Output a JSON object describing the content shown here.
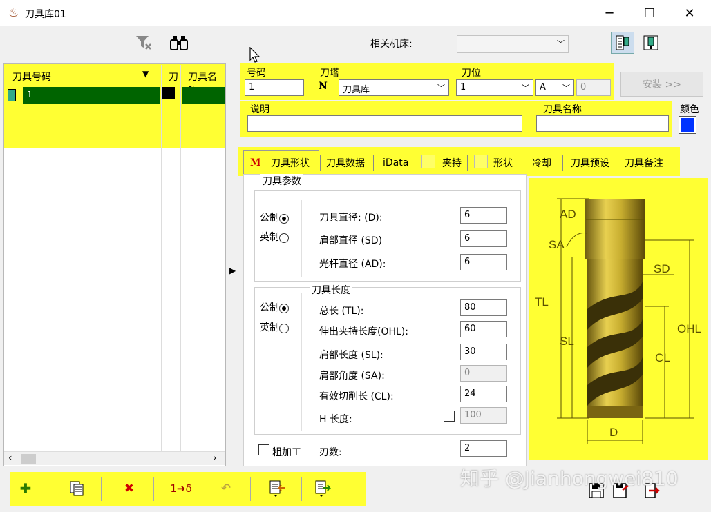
{
  "window": {
    "title": "刀具库01",
    "minimize": "─",
    "maximize": "☐",
    "close": "✕"
  },
  "toolbar_top": {
    "filter_clear_icon": "filter-clear-icon",
    "find_icon": "binoculars-icon",
    "machine_label": "相关机床:",
    "machine_value": ""
  },
  "grid": {
    "headers": [
      "刀具号码",
      "刀",
      "刀具名称"
    ],
    "rows": [
      {
        "number": "1",
        "name": ""
      }
    ]
  },
  "fields": {
    "number_label": "号码",
    "number_value": "1",
    "turret_label": "刀塔",
    "turret_prefix": "N",
    "turret_value": "刀具库",
    "position_label": "刀位",
    "position_value": "1",
    "position_sub": "A",
    "position_num": "0",
    "install_button": "安装 >>",
    "desc_label": "说明",
    "desc_value": "",
    "name_label": "刀具名称",
    "name_value": "",
    "color_label": "颜色",
    "color_value": "#0033ff"
  },
  "tabs": {
    "mark": "M",
    "items": [
      "刀具形状",
      "刀具数据",
      "iData",
      "夹持",
      "形状",
      "冷却",
      "刀具预设",
      "刀具备注"
    ]
  },
  "params": {
    "group_title": "刀具参数",
    "metric": "公制",
    "imperial": "英制",
    "unit_selected": "metric",
    "diameter_label": "刀具直径: (D):",
    "diameter_value": "6",
    "shoulder_dia_label": "肩部直径 (SD)",
    "shoulder_dia_value": "6",
    "shank_dia_label": "光杆直径 (AD):",
    "shank_dia_value": "6"
  },
  "lengths": {
    "group_title": "刀具长度",
    "metric": "公制",
    "imperial": "英制",
    "total_label": "总长 (TL):",
    "total_value": "80",
    "overhang_label": "伸出夹持长度(OHL):",
    "overhang_value": "60",
    "shoulder_len_label": "肩部长度 (SL):",
    "shoulder_len_value": "30",
    "shoulder_angle_label": "肩部角度 (SA):",
    "shoulder_angle_value": "0",
    "cutting_len_label": "有效切削长 (CL):",
    "cutting_len_value": "24",
    "h_len_label": "H 长度:",
    "h_len_value": "100",
    "rough_label": "粗加工",
    "flutes_label": "刃数:",
    "flutes_value": "2"
  },
  "diagram": {
    "AD": "AD",
    "SA": "SA",
    "SD": "SD",
    "TL": "TL",
    "SL": "SL",
    "OHL": "OHL",
    "CL": "CL",
    "D": "D"
  },
  "watermark": "知乎 @Jianhongwei810",
  "colors": {
    "highlight": "#ffff33",
    "selected_row": "#006400",
    "accent": "#0033ff"
  }
}
